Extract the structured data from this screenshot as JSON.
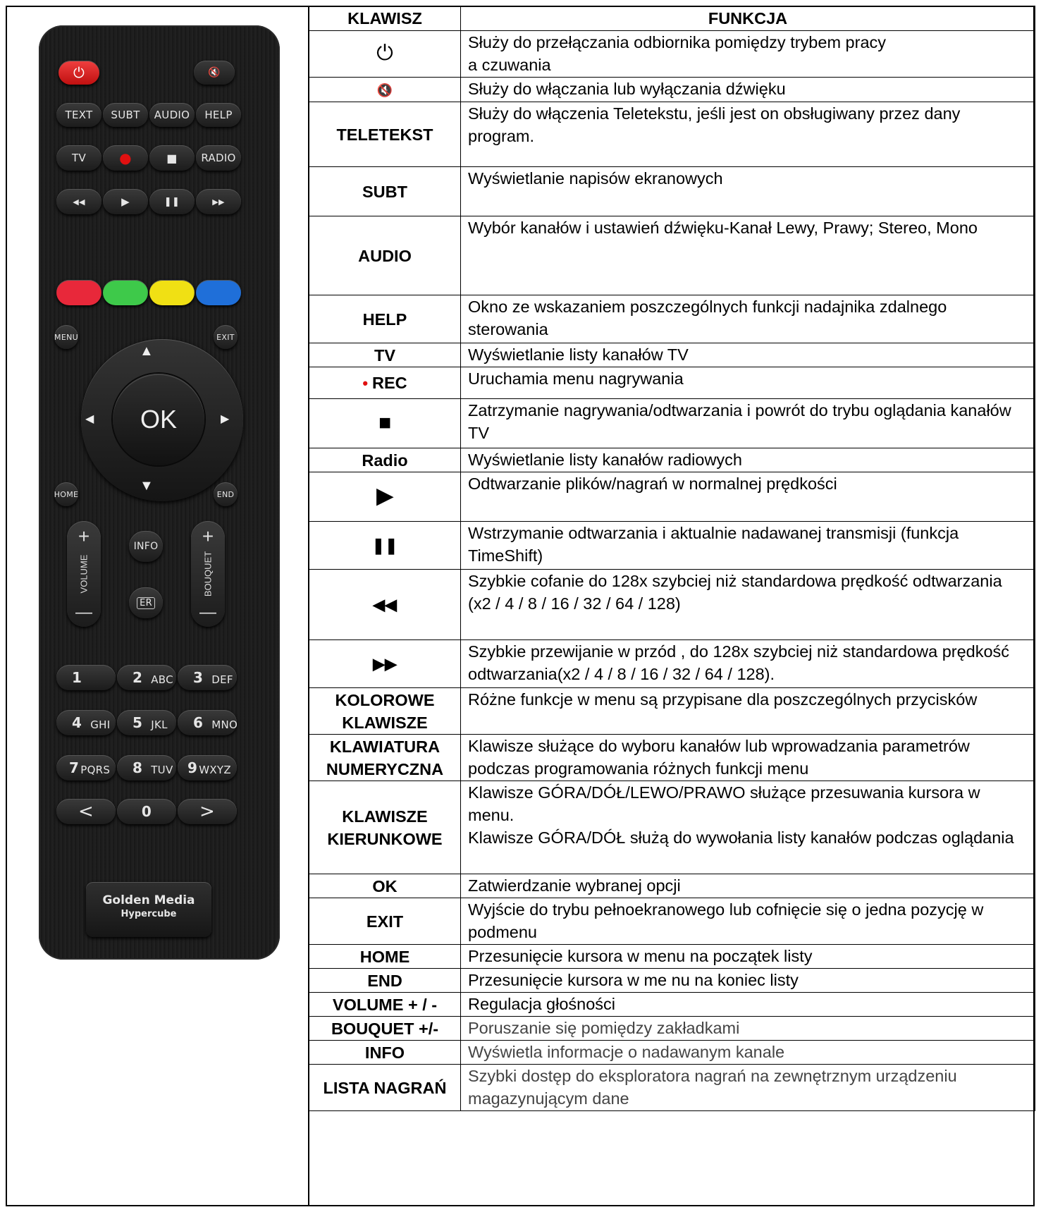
{
  "remote": {
    "power_symbol": "⏻",
    "mute_symbol": "🔇",
    "row1": [
      "TEXT",
      "SUBT",
      "AUDIO",
      "HELP"
    ],
    "row2": [
      "TV",
      "●",
      "■",
      "RADIO"
    ],
    "row3": [
      "◀◀",
      "▶",
      "❚❚",
      "▶▶"
    ],
    "colors": {
      "red": "#e8283a",
      "green": "#3ec94a",
      "yellow": "#f0e014",
      "blue": "#1f6fd9"
    },
    "menu": "MENU",
    "exit": "EXIT",
    "ok": "OK",
    "home": "HOME",
    "end": "END",
    "info": "INFO",
    "er": "ER",
    "volume": "VOLUME",
    "bouquet": "BOUQUET",
    "plus": "+",
    "minus": "—",
    "up": "▲",
    "down": "▼",
    "left": "◀",
    "right": "▶",
    "nums": [
      {
        "d": "1",
        "l": ""
      },
      {
        "d": "2",
        "l": "ABC"
      },
      {
        "d": "3",
        "l": "DEF"
      },
      {
        "d": "4",
        "l": "GHI"
      },
      {
        "d": "5",
        "l": "JKL"
      },
      {
        "d": "6",
        "l": "MNO"
      },
      {
        "d": "7",
        "l": "PQRS"
      },
      {
        "d": "8",
        "l": "TUV"
      },
      {
        "d": "9",
        "l": "WXYZ"
      }
    ],
    "lt": "<",
    "zero": "0",
    "gt": ">",
    "brand1": "Golden Media",
    "brand2": "Hypercube"
  },
  "table": {
    "header": {
      "key": "KLAWISZ",
      "func": "FUNKCJA"
    },
    "rows": [
      {
        "key": "⏻",
        "func": "Służy do przełączania odbiornika pomiędzy trybem pracy\na czuwania"
      },
      {
        "key": "🔇",
        "func": "Służy do włączania lub wyłączania dźwięku"
      },
      {
        "key": "TELETEKST",
        "func": "Służy do włączenia Teletekstu, jeśli jest on obsługiwany przez dany program."
      },
      {
        "key": "SUBT",
        "func": "Wyświetlanie napisów ekranowych"
      },
      {
        "key": "AUDIO",
        "func": "Wybór kanałów i ustawień dźwięku-Kanał Lewy, Prawy; Stereo, Mono"
      },
      {
        "key": "HELP",
        "func": "Okno ze wskazaniem poszczególnych funkcji nadajnika zdalnego sterowania"
      },
      {
        "key": "TV",
        "func": "Wyświetlanie listy kanałów TV"
      },
      {
        "key": "REC",
        "func": "Uruchamia menu nagrywania"
      },
      {
        "key": "■",
        "func": "Zatrzymanie nagrywania/odtwarzania i powrót do trybu oglądania kanałów TV"
      },
      {
        "key": "Radio",
        "func": "Wyświetlanie listy kanałów radiowych"
      },
      {
        "key": "▶",
        "func": "Odtwarzanie plików/nagrań w normalnej prędkości"
      },
      {
        "key": "❚❚",
        "func": "Wstrzymanie odtwarzania i aktualnie nadawanej transmisji (funkcja TimeShift)"
      },
      {
        "key": "◀◀",
        "func": "Szybkie cofanie do 128x szybciej niż standardowa prędkość odtwarzania\n(x2 / 4 / 8 / 16 / 32 / 64 / 128)"
      },
      {
        "key": "▶▶",
        "func": "Szybkie przewijanie w przód , do 128x szybciej niż standardowa prędkość odtwarzania(x2 / 4 / 8 / 16 / 32 / 64 / 128)."
      },
      {
        "key": "KOLOROWE KLAWISZE",
        "func": "Różne funkcje w menu są przypisane dla poszczególnych przycisków"
      },
      {
        "key": "KLAWIATURA NUMERYCZNA",
        "func": "Klawisze służące do wyboru kanałów lub wprowadzania parametrów podczas programowania różnych funkcji menu"
      },
      {
        "key": "KLAWISZE KIERUNKOWE",
        "func": "Klawisze GÓRA/DÓŁ/LEWO/PRAWO służące przesuwania kursora w menu.\nKlawisze GÓRA/DÓŁ służą do wywołania listy kanałów podczas oglądania"
      },
      {
        "key": "OK",
        "func": "Zatwierdzanie wybranej opcji"
      },
      {
        "key": "EXIT",
        "func": "Wyjście do trybu pełnoekranowego lub cofnięcie się o jedna pozycję w podmenu"
      },
      {
        "key": "HOME",
        "func": "Przesunięcie kursora w menu na początek listy"
      },
      {
        "key": "END",
        "func": "Przesunięcie kursora w me nu na koniec listy"
      },
      {
        "key": "VOLUME + / -",
        "func": "Regulacja głośności"
      },
      {
        "key": "BOUQUET +/-",
        "func": "Poruszanie się pomiędzy zakładkami"
      },
      {
        "key": "INFO",
        "func": "Wyświetla informacje o nadawanym kanale"
      },
      {
        "key": "LISTA NAGRAŃ",
        "func": "Szybki dostęp do eksploratora nagrań na zewnętrznym urządzeniu magazynującym dane"
      }
    ]
  }
}
